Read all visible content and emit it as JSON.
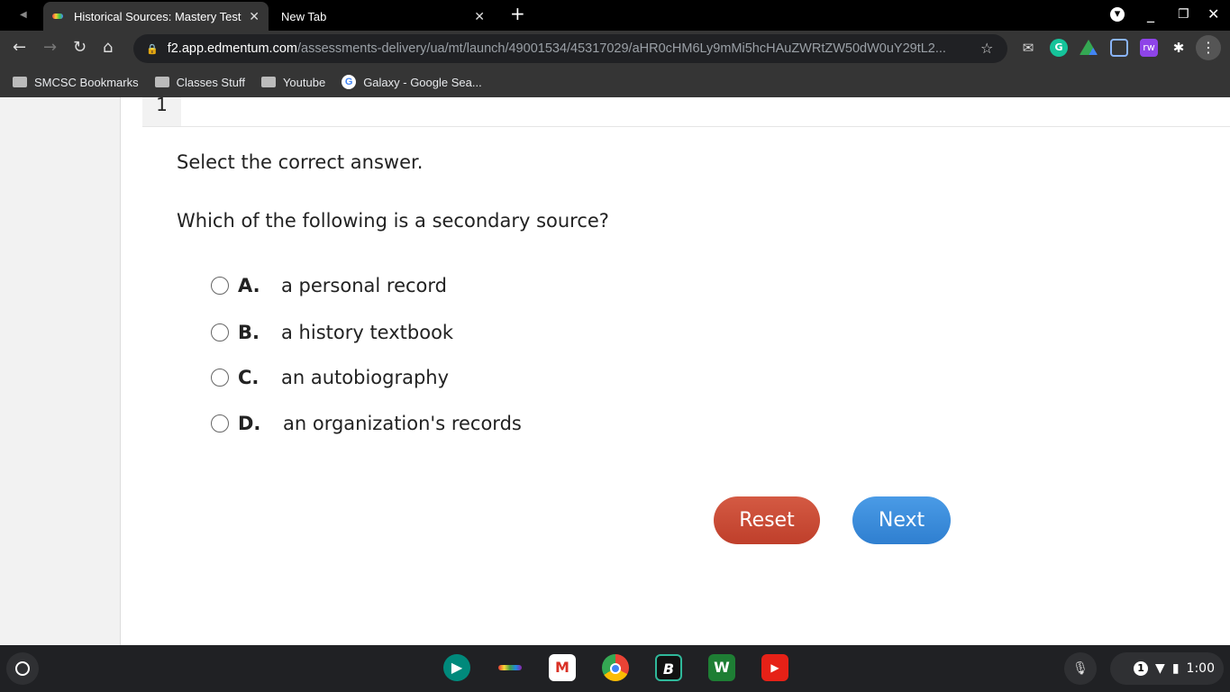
{
  "browser": {
    "tabs": [
      {
        "label": "Historical Sources: Mastery Test",
        "active": true
      },
      {
        "label": "New Tab",
        "active": false
      }
    ],
    "url_host": "f2.app.edmentum.com",
    "url_path": "/assessments-delivery/ua/mt/launch/49001534/45317029/aHR0cHM6Ly9mMi5hcHAuZWRtZW50dW0uY29tL2...",
    "bookmarks": [
      "SMCSC Bookmarks",
      "Classes Stuff",
      "Youtube",
      "Galaxy - Google Sea..."
    ],
    "extensions": {
      "grammarly": "G",
      "rw": "rw"
    }
  },
  "question": {
    "number": "1",
    "prompt": "Select the correct answer.",
    "text": "Which of the following is a secondary source?",
    "choices": [
      {
        "letter": "A.",
        "text": "a personal record"
      },
      {
        "letter": "B.",
        "text": "a history textbook"
      },
      {
        "letter": "C.",
        "text": "an autobiography"
      },
      {
        "letter": "D.",
        "text": "an organization's records"
      }
    ],
    "reset_label": "Reset",
    "next_label": "Next"
  },
  "shelf": {
    "apps": [
      "meet",
      "multicolor",
      "gmail",
      "chrome",
      "B",
      "classroom-w",
      "youtube"
    ],
    "b_label": "B",
    "notification_count": "1",
    "time": "1:00"
  },
  "colors": {
    "reset": "#c94a35",
    "next": "#3b8bdb"
  }
}
